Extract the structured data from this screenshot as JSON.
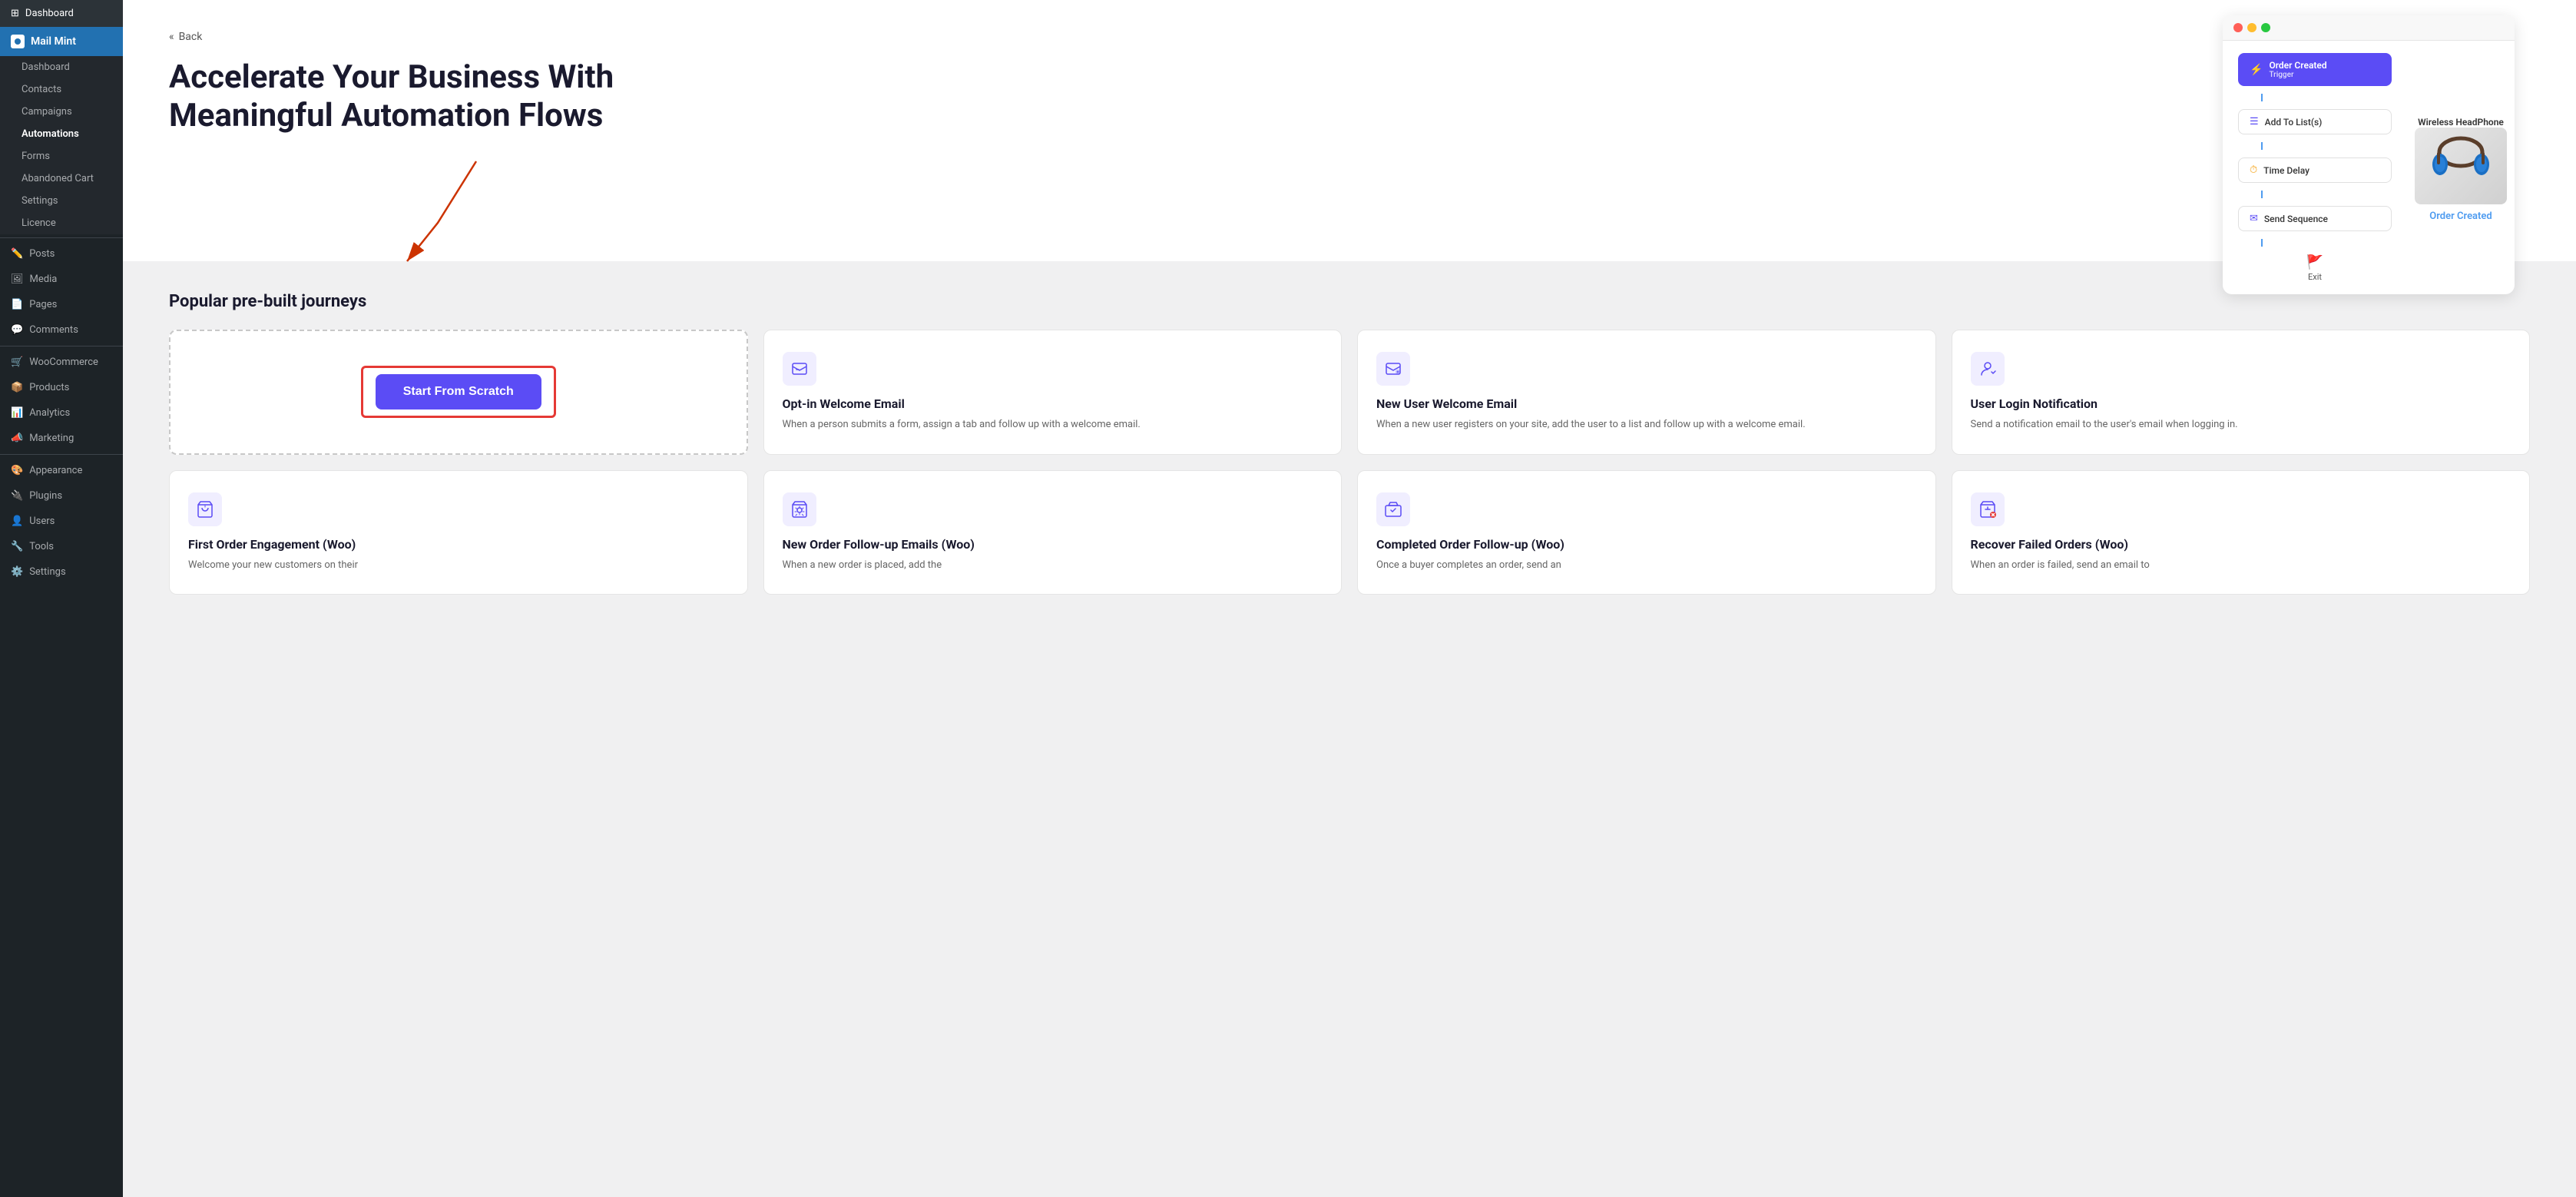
{
  "sidebar": {
    "dashboard_label": "Dashboard",
    "mailmint_label": "Mail Mint",
    "submenu": {
      "dashboard": "Dashboard",
      "contacts": "Contacts",
      "campaigns": "Campaigns",
      "automations": "Automations",
      "forms": "Forms",
      "abandoned_cart": "Abandoned Cart",
      "settings": "Settings",
      "licence": "Licence"
    },
    "wp_items": [
      {
        "label": "Posts",
        "icon": "📝"
      },
      {
        "label": "Media",
        "icon": "🖼"
      },
      {
        "label": "Pages",
        "icon": "📄"
      },
      {
        "label": "Comments",
        "icon": "💬"
      },
      {
        "label": "WooCommerce",
        "icon": "🛒"
      },
      {
        "label": "Products",
        "icon": "📦"
      },
      {
        "label": "Analytics",
        "icon": "📊"
      },
      {
        "label": "Marketing",
        "icon": "📣"
      },
      {
        "label": "Appearance",
        "icon": "🎨"
      },
      {
        "label": "Plugins",
        "icon": "🔌"
      },
      {
        "label": "Users",
        "icon": "👤"
      },
      {
        "label": "Tools",
        "icon": "🔧"
      },
      {
        "label": "Settings",
        "icon": "⚙"
      }
    ]
  },
  "header": {
    "back_label": "Back",
    "title_line1": "Accelerate Your Business With",
    "title_line2": "Meaningful Automation Flows"
  },
  "preview": {
    "product_title": "Wireless HeadPhone",
    "order_label": "Order Created",
    "nodes": [
      {
        "label": "Order Created",
        "sublabel": "Trigger",
        "type": "trigger"
      },
      {
        "label": "Add To List(s)",
        "type": "action"
      },
      {
        "label": "Time Delay",
        "type": "action"
      },
      {
        "label": "Send Sequence",
        "type": "action"
      },
      {
        "label": "Exit",
        "type": "exit"
      }
    ]
  },
  "popular": {
    "section_title": "Popular pre-built journeys",
    "scratch_button_label": "Start From Scratch",
    "cards": [
      {
        "id": "optin",
        "title": "Opt-in Welcome Email",
        "desc": "When a person submits a form, assign a tab and follow up with a welcome email.",
        "icon": "form"
      },
      {
        "id": "new-user",
        "title": "New User Welcome Email",
        "desc": "When a new user registers on your site, add the user to a list and follow up with a welcome email.",
        "icon": "user"
      },
      {
        "id": "login",
        "title": "User Login Notification",
        "desc": "Send a notification email to the user's email when logging in.",
        "icon": "login"
      }
    ],
    "cards_row2": [
      {
        "id": "first-order",
        "title": "First Order Engagement (Woo)",
        "desc": "Welcome your new customers on their",
        "icon": "order"
      },
      {
        "id": "new-order",
        "title": "New Order Follow-up Emails (Woo)",
        "desc": "When a new order is placed, add the",
        "icon": "cart"
      },
      {
        "id": "completed",
        "title": "Completed Order Follow-up (Woo)",
        "desc": "Once a buyer completes an order, send an",
        "icon": "box"
      },
      {
        "id": "failed",
        "title": "Recover Failed Orders (Woo)",
        "desc": "When an order is failed, send an email to",
        "icon": "cart-fail"
      }
    ]
  }
}
